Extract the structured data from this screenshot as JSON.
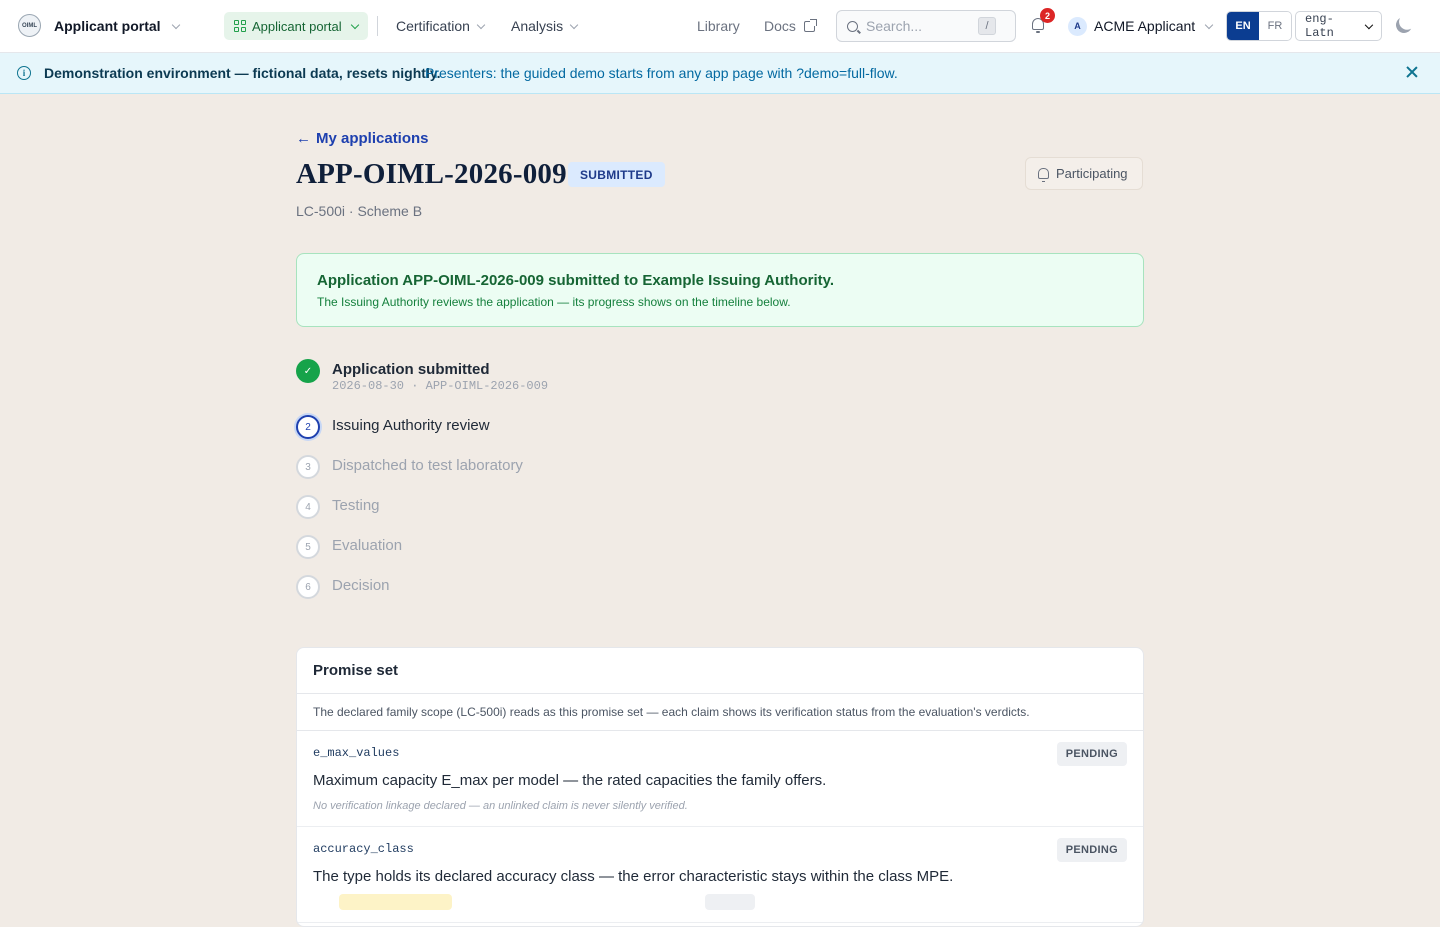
{
  "nav": {
    "logo_text": "OIML",
    "app_name": "Applicant portal",
    "portal_pill": "Applicant portal",
    "certification": "Certification",
    "analysis": "Analysis",
    "library": "Library",
    "docs": "Docs",
    "search_placeholder": "Search...",
    "search_shortcut": "/",
    "notifications_count": "2",
    "user_initial": "A",
    "user_name": "ACME Applicant",
    "lang_en": "EN",
    "lang_fr": "FR",
    "script_value": "eng-Latn"
  },
  "banner": {
    "strong": "Demonstration environment — fictional data, resets nightly.",
    "text": "Presenters: the guided demo starts from any app page with ?demo=full-flow."
  },
  "page": {
    "back_link": "My applications",
    "title": "APP-OIML-2026-009",
    "status": "SUBMITTED",
    "participating": "Participating",
    "subtitle": "LC-500i · Scheme B"
  },
  "notice": {
    "title": "Application APP-OIML-2026-009 submitted to Example Issuing Authority.",
    "text": "The Issuing Authority reviews the application — its progress shows on the timeline below."
  },
  "timeline": {
    "meta": "2026-08-30 · APP-OIML-2026-009",
    "steps": [
      {
        "marker": "✓",
        "label": "Application submitted"
      },
      {
        "marker": "2",
        "label": "Issuing Authority review"
      },
      {
        "marker": "3",
        "label": "Dispatched to test laboratory"
      },
      {
        "marker": "4",
        "label": "Testing"
      },
      {
        "marker": "5",
        "label": "Evaluation"
      },
      {
        "marker": "6",
        "label": "Decision"
      }
    ]
  },
  "promise_set": {
    "title": "Promise set",
    "description": "The declared family scope (LC-500i) reads as this promise set — each claim shows its verification status from the evaluation's verdicts.",
    "claims": [
      {
        "key": "e_max_values",
        "status": "PENDING",
        "text": "Maximum capacity E_max per model — the rated capacities the family offers.",
        "note": "No verification linkage declared — an unlinked claim is never silently verified."
      },
      {
        "key": "accuracy_class",
        "status": "PENDING",
        "text": "The type holds its declared accuracy class — the error characteristic stays within the class MPE.",
        "note": ""
      }
    ]
  }
}
